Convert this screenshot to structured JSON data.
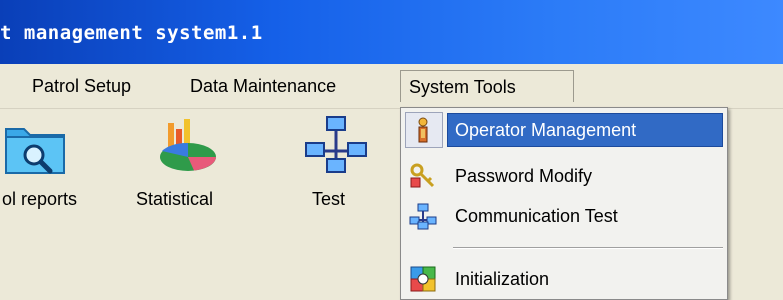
{
  "window": {
    "title": "t management system1.1"
  },
  "menubar": {
    "items": [
      {
        "label": "Patrol Setup"
      },
      {
        "label": "Data Maintenance"
      },
      {
        "label": "System Tools"
      }
    ]
  },
  "toolbar": {
    "items": [
      {
        "label": "ol reports",
        "icon": "folder-search-icon"
      },
      {
        "label": "Statistical",
        "icon": "pie-chart-icon"
      },
      {
        "label": "Test",
        "icon": "network-computers-icon"
      }
    ]
  },
  "dropdown": {
    "items": [
      {
        "label": "Operator Management",
        "icon": "operator-icon",
        "selected": true
      },
      {
        "label": "Password Modify",
        "icon": "keys-icon"
      },
      {
        "label": "Communication Test",
        "icon": "network-icon"
      },
      {
        "label": "Initialization",
        "icon": "initialization-icon"
      }
    ]
  },
  "colors": {
    "titlebar": "#1560e8",
    "highlight": "#316ac5",
    "face": "#ece9d8"
  }
}
